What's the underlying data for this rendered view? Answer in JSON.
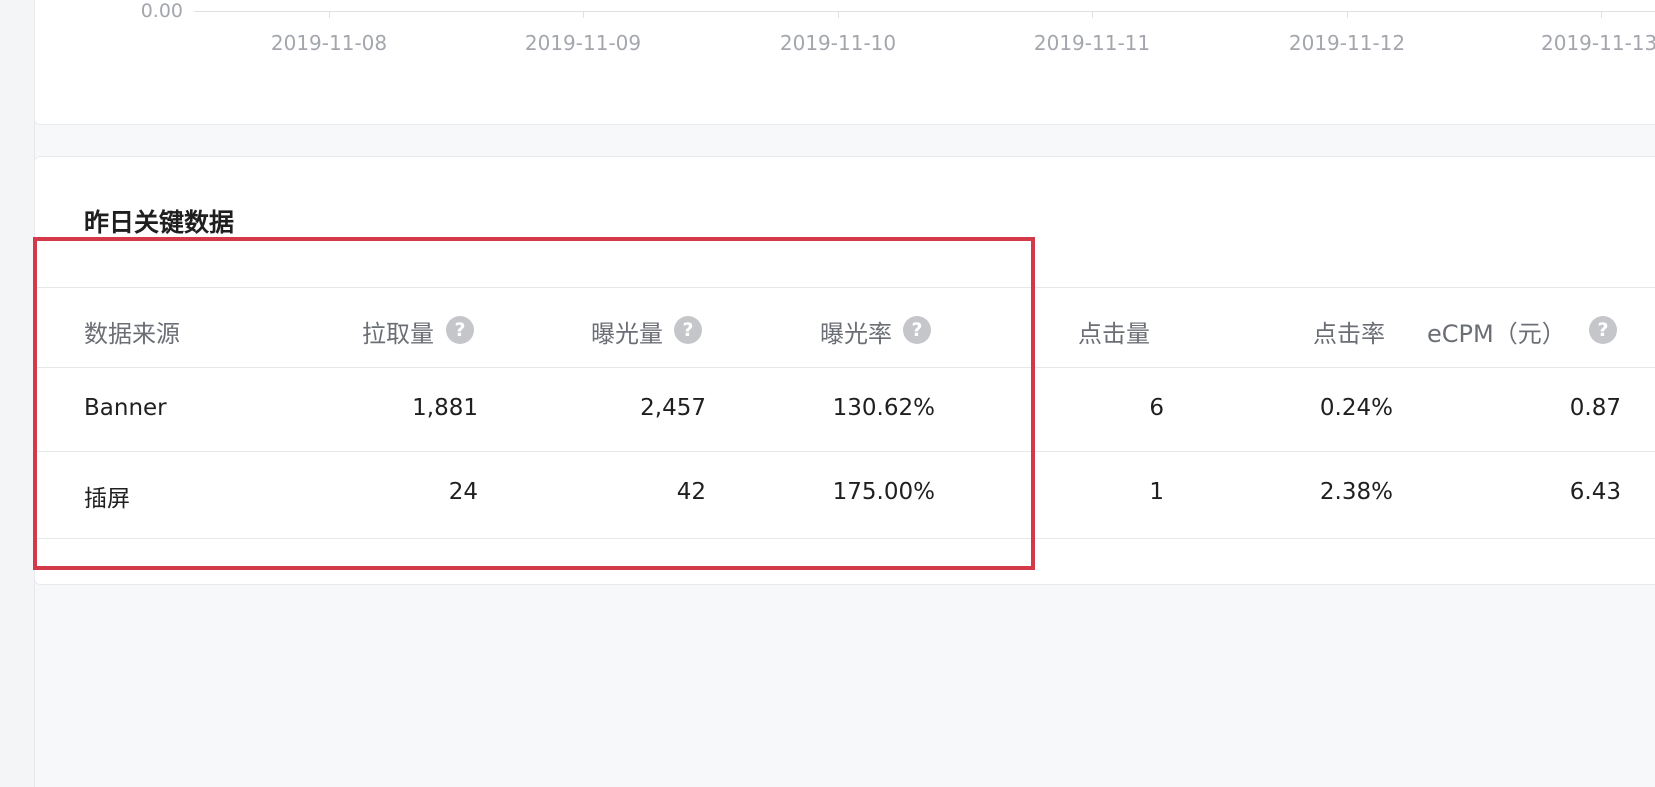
{
  "chart": {
    "y_zero_label": "0.00",
    "x_tick_labels": [
      "2019-11-08",
      "2019-11-09",
      "2019-11-10",
      "2019-11-11",
      "2019-11-12",
      "2019-11-13"
    ]
  },
  "table": {
    "title": "昨日关键数据",
    "columns": [
      {
        "label": "数据来源",
        "help": false
      },
      {
        "label": "拉取量",
        "help": true
      },
      {
        "label": "曝光量",
        "help": true
      },
      {
        "label": "曝光率",
        "help": true
      },
      {
        "label": "点击量",
        "help": false
      },
      {
        "label": "点击率",
        "help": false
      },
      {
        "label": "eCPM（元）",
        "help": true
      }
    ],
    "help_glyph": "?",
    "rows": [
      {
        "source": "Banner",
        "pulls": "1,881",
        "impressions": "2,457",
        "impression_rate": "130.62%",
        "clicks": "6",
        "ctr": "0.24%",
        "ecpm": "0.87"
      },
      {
        "source": "插屏",
        "pulls": "24",
        "impressions": "42",
        "impression_rate": "175.00%",
        "clicks": "1",
        "ctr": "2.38%",
        "ecpm": "6.43"
      }
    ]
  },
  "colors": {
    "highlight_border": "#d43949",
    "help_icon": "#c4c6c9"
  }
}
